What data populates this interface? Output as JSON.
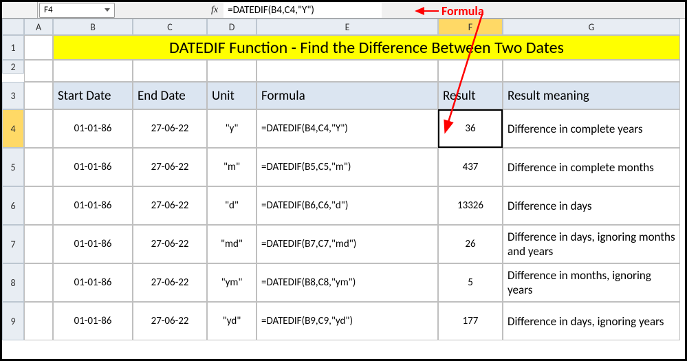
{
  "topbar": {
    "namebox": "F4",
    "fx_label": "fx",
    "formula": "=DATEDIF(B4,C4,\"Y\")",
    "annotation": "Formula"
  },
  "columns": [
    "A",
    "B",
    "C",
    "D",
    "E",
    "F",
    "G"
  ],
  "rows_labels": [
    "1",
    "2",
    "3",
    "4",
    "5",
    "6",
    "7",
    "8",
    "9"
  ],
  "title": "DATEDIF Function - Find the Difference Between Two Dates",
  "headers": {
    "b": "Start Date",
    "c": "End Date",
    "d": "Unit",
    "e": "Formula",
    "f": "Result",
    "g": "Result meaning"
  },
  "rows": [
    {
      "start": "01-01-86",
      "end": "27-06-22",
      "unit": "\"y\"",
      "formula": "=DATEDIF(B4,C4,\"Y\")",
      "result": "36",
      "meaning": "Difference in complete years"
    },
    {
      "start": "01-01-86",
      "end": "27-06-22",
      "unit": "\"m\"",
      "formula": "=DATEDIF(B5,C5,\"m\")",
      "result": "437",
      "meaning": "Difference in complete months"
    },
    {
      "start": "01-01-86",
      "end": "27-06-22",
      "unit": "\"d\"",
      "formula": "=DATEDIF(B6,C6,\"d\")",
      "result": "13326",
      "meaning": "Difference in days"
    },
    {
      "start": "01-01-86",
      "end": "27-06-22",
      "unit": "\"md\"",
      "formula": "=DATEDIF(B7,C7,\"md\")",
      "result": "26",
      "meaning": "Difference in days, ignoring months and years"
    },
    {
      "start": "01-01-86",
      "end": "27-06-22",
      "unit": "\"ym\"",
      "formula": "=DATEDIF(B8,C8,\"ym\")",
      "result": "5",
      "meaning": "Difference in months, ignoring years"
    },
    {
      "start": "01-01-86",
      "end": "27-06-22",
      "unit": "\"yd\"",
      "formula": "=DATEDIF(B9,C9,\"yd\")",
      "result": "177",
      "meaning": "Difference in days, ignoring years"
    }
  ]
}
